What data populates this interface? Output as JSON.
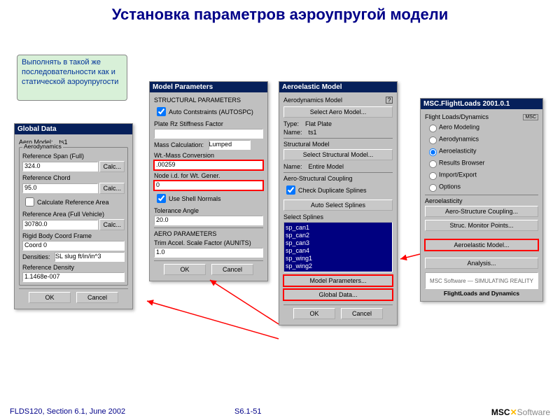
{
  "title": "Установка параметров аэроупругой модели",
  "note": "Выполнять в такой же последовательности как и статической аэроупругости",
  "footer": {
    "left": "FLDS120, Section 6.1, June 2002",
    "mid": "S6.1-51",
    "right_prefix": "MSC",
    "right_suffix": "Software"
  },
  "global": {
    "title": "Global Data",
    "aero_model_lbl": "Aero Model:",
    "aero_model_val": "ts1",
    "group_lbl": "Aerodynamics",
    "ref_span_lbl": "Reference Span (Full)",
    "ref_span_val": "324.0",
    "ref_chord_lbl": "Reference Chord",
    "ref_chord_val": "95.0",
    "calc_area_lbl": "Calculate Reference Area",
    "ref_area_lbl": "Reference Area (Full Vehicle)",
    "ref_area_val": "30780.0",
    "rb_frame_lbl": "Rigid Body Coord Frame",
    "rb_frame_val": "Coord 0",
    "densities_lbl": "Densities:",
    "densities_val": "SL slug ft/in/in^3",
    "ref_dens_lbl": "Reference Density",
    "ref_dens_val": "1.1468e-007",
    "calc_btn": "Calc...",
    "ok": "OK",
    "cancel": "Cancel"
  },
  "params": {
    "title": "Model Parameters",
    "sect_struct": "STRUCTURAL PARAMETERS",
    "auto_constr": "Auto Contstraints (AUTOSPC)",
    "plate_rz_lbl": "Plate Rz Stiffness Factor",
    "plate_rz_val": "",
    "mass_calc_lbl": "Mass Calculation:",
    "mass_calc_val": "Lumped",
    "wt_mass_lbl": "Wt.-Mass Conversion",
    "wt_mass_val": ".00259",
    "node_id_lbl": "Node i.d. for Wt. Gener.",
    "node_id_val": "0",
    "shell_norm": "Use Shell Normals",
    "tol_angle_lbl": "Tolerance Angle",
    "tol_angle_val": "20.0",
    "sect_aero": "AERO PARAMETERS",
    "trim_scale_lbl": "Trim Accel. Scale Factor (AUNITS)",
    "trim_scale_val": "1.0",
    "ok": "OK",
    "cancel": "Cancel"
  },
  "aero": {
    "title": "Aeroelastic Model",
    "aero_model_hdr": "Aerodynamics Model",
    "sel_aero_btn": "Select Aero Model...",
    "type_lbl": "Type:",
    "type_val": "Flat Plate",
    "name_lbl": "Name:",
    "name_val": "ts1",
    "struct_model_hdr": "Structural Model",
    "sel_struct_btn": "Select Structural Model...",
    "struct_name_lbl": "Name:",
    "struct_name_val": "Entire Model",
    "coupling_hdr": "Aero-Structural Coupling",
    "chk_dup": "Check Duplicate Splines",
    "auto_sel_btn": "Auto Select Splines",
    "sel_splines_lbl": "Select Splines",
    "splines": [
      "sp_can1",
      "sp_can2",
      "sp_can3",
      "sp_can4",
      "sp_wing1",
      "sp_wing2"
    ],
    "model_params_btn": "Model Parameters...",
    "global_data_btn": "Global Data...",
    "ok": "OK",
    "cancel": "Cancel"
  },
  "flight": {
    "title": "MSC.FlightLoads 2001.0.1",
    "sect": "Flight Loads/Dynamics",
    "opts": [
      "Aero Modeling",
      "Aerodynamics",
      "Aeroelasticity",
      "Results Browser",
      "Import/Export",
      "Options"
    ],
    "selected": 2,
    "sect2": "Aeroelasticity",
    "btn1": "Aero-Structure Coupling...",
    "btn2": "Struc. Monitor Points...",
    "btn3": "Aeroelastic Model...",
    "btn4": "Analysis...",
    "logo1": "MSC Software — SIMULATING REALITY",
    "logo2": "FlightLoads and Dynamics"
  }
}
